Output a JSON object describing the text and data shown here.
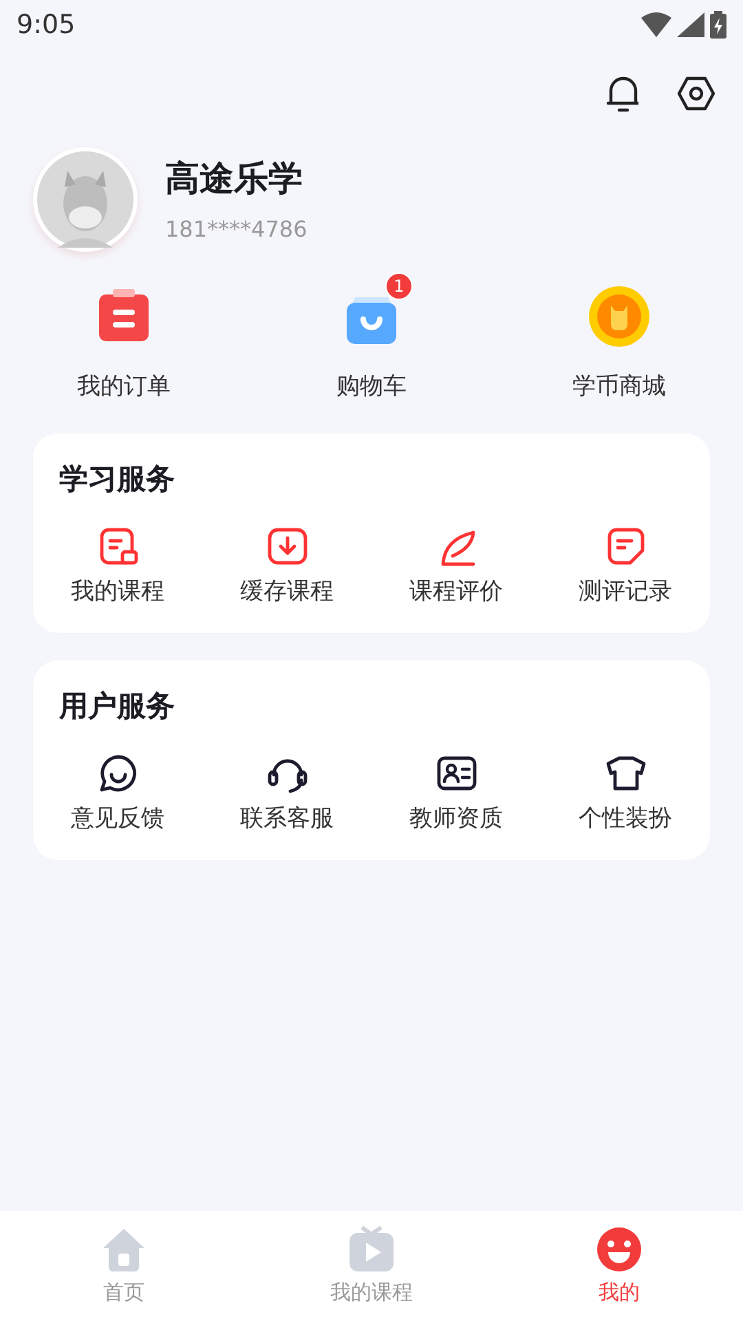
{
  "status_bar": {
    "time": "9:05"
  },
  "profile": {
    "name": "高途乐学",
    "phone": "181****4786"
  },
  "shortcuts": [
    {
      "label": "我的订单"
    },
    {
      "label": "购物车",
      "badge": "1"
    },
    {
      "label": "学币商城"
    }
  ],
  "sections": [
    {
      "title": "学习服务",
      "items": [
        {
          "label": "我的课程"
        },
        {
          "label": "缓存课程"
        },
        {
          "label": "课程评价"
        },
        {
          "label": "测评记录"
        }
      ]
    },
    {
      "title": "用户服务",
      "items": [
        {
          "label": "意见反馈"
        },
        {
          "label": "联系客服"
        },
        {
          "label": "教师资质"
        },
        {
          "label": "个性装扮"
        }
      ]
    }
  ],
  "tab_bar": [
    {
      "label": "首页",
      "selected": false
    },
    {
      "label": "我的课程",
      "selected": false
    },
    {
      "label": "我的",
      "selected": true
    }
  ]
}
